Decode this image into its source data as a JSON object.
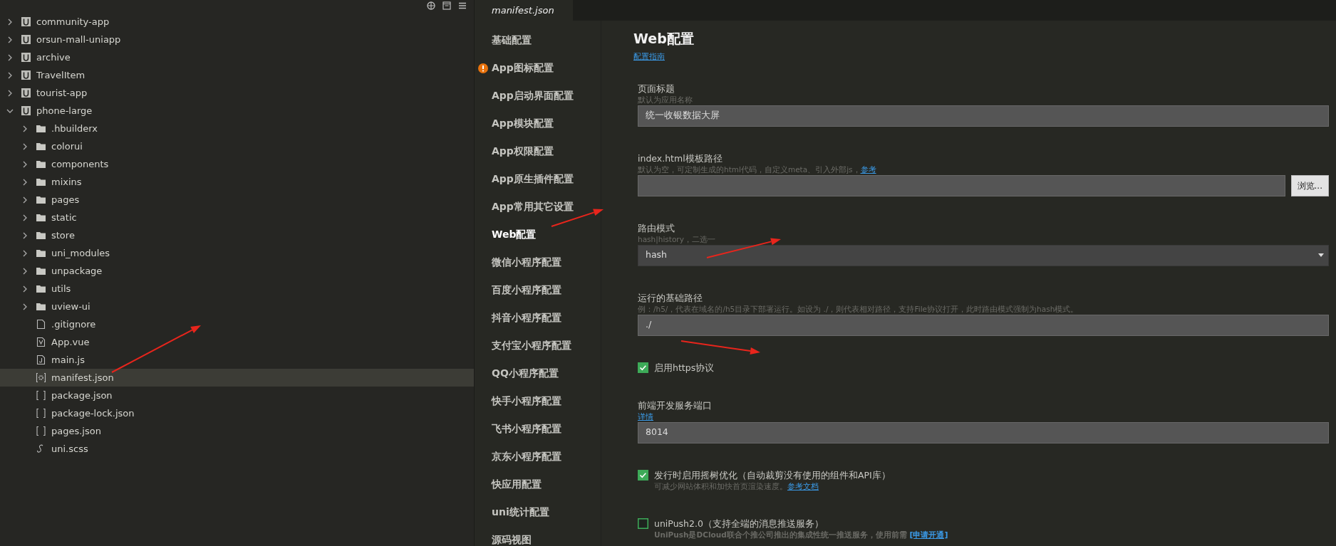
{
  "file_tree": [
    {
      "label": "community-app",
      "kind": "project",
      "expanded": false,
      "selected": false
    },
    {
      "label": "orsun-mall-uniapp",
      "kind": "project",
      "expanded": false,
      "selected": false
    },
    {
      "label": "archive",
      "kind": "project",
      "expanded": false,
      "selected": false
    },
    {
      "label": "TravelItem",
      "kind": "project",
      "expanded": false,
      "selected": false
    },
    {
      "label": "tourist-app",
      "kind": "project",
      "expanded": false,
      "selected": false
    },
    {
      "label": "phone-large",
      "kind": "project",
      "expanded": true,
      "selected": false,
      "children": [
        {
          "label": ".hbuilderx",
          "kind": "folder",
          "expanded": false,
          "selected": false
        },
        {
          "label": "colorui",
          "kind": "folder",
          "expanded": false,
          "selected": false
        },
        {
          "label": "components",
          "kind": "folder",
          "expanded": false,
          "selected": false
        },
        {
          "label": "mixins",
          "kind": "folder",
          "expanded": false,
          "selected": false
        },
        {
          "label": "pages",
          "kind": "folder",
          "expanded": false,
          "selected": false
        },
        {
          "label": "static",
          "kind": "folder",
          "expanded": false,
          "selected": false
        },
        {
          "label": "store",
          "kind": "folder",
          "expanded": false,
          "selected": false
        },
        {
          "label": "uni_modules",
          "kind": "folder",
          "expanded": false,
          "selected": false
        },
        {
          "label": "unpackage",
          "kind": "folder",
          "expanded": false,
          "selected": false
        },
        {
          "label": "utils",
          "kind": "folder",
          "expanded": false,
          "selected": false
        },
        {
          "label": "uview-ui",
          "kind": "folder",
          "expanded": false,
          "selected": false
        },
        {
          "label": ".gitignore",
          "kind": "plain",
          "selected": false
        },
        {
          "label": "App.vue",
          "kind": "vue",
          "selected": false
        },
        {
          "label": "main.js",
          "kind": "js",
          "selected": false
        },
        {
          "label": "manifest.json",
          "kind": "manifest",
          "selected": true
        },
        {
          "label": "package.json",
          "kind": "json",
          "selected": false
        },
        {
          "label": "package-lock.json",
          "kind": "json",
          "selected": false
        },
        {
          "label": "pages.json",
          "kind": "json",
          "selected": false
        },
        {
          "label": "uni.scss",
          "kind": "style",
          "selected": false
        }
      ]
    }
  ],
  "tab": {
    "label": "manifest.json"
  },
  "nav": [
    {
      "label": "基础配置",
      "selected": false,
      "warning": false
    },
    {
      "label": "App图标配置",
      "selected": false,
      "warning": true
    },
    {
      "label": "App启动界面配置",
      "selected": false,
      "warning": false
    },
    {
      "label": "App模块配置",
      "selected": false,
      "warning": false
    },
    {
      "label": "App权限配置",
      "selected": false,
      "warning": false
    },
    {
      "label": "App原生插件配置",
      "selected": false,
      "warning": false
    },
    {
      "label": "App常用其它设置",
      "selected": false,
      "warning": false
    },
    {
      "label": "Web配置",
      "selected": true,
      "warning": false
    },
    {
      "label": "微信小程序配置",
      "selected": false,
      "warning": false
    },
    {
      "label": "百度小程序配置",
      "selected": false,
      "warning": false
    },
    {
      "label": "抖音小程序配置",
      "selected": false,
      "warning": false
    },
    {
      "label": "支付宝小程序配置",
      "selected": false,
      "warning": false
    },
    {
      "label": "QQ小程序配置",
      "selected": false,
      "warning": false
    },
    {
      "label": "快手小程序配置",
      "selected": false,
      "warning": false
    },
    {
      "label": "飞书小程序配置",
      "selected": false,
      "warning": false
    },
    {
      "label": "京东小程序配置",
      "selected": false,
      "warning": false
    },
    {
      "label": "快应用配置",
      "selected": false,
      "warning": false
    },
    {
      "label": "uni统计配置",
      "selected": false,
      "warning": false
    },
    {
      "label": "源码视图",
      "selected": false,
      "warning": false
    }
  ],
  "content": {
    "title": "Web配置",
    "guide_link": "配置指南",
    "fields": [
      {
        "kind": "text",
        "label": "页面标题",
        "hint": "默认为应用名称",
        "value": "统一收银数据大屏"
      },
      {
        "kind": "file",
        "label": "index.html模板路径",
        "hint": "默认为空，可定制生成的html代码，自定义meta、引入外部js，",
        "hint_link": "参考",
        "button": "浏览..."
      },
      {
        "kind": "select",
        "label": "路由模式",
        "hint": "hash|history，二选一",
        "value": "hash"
      },
      {
        "kind": "text",
        "label": "运行的基础路径",
        "hint": "例：/h5/，代表在域名的/h5目录下部署运行。如设为 ./，则代表相对路径，支持File协议打开，此时路由模式强制为hash模式。",
        "value": "./"
      },
      {
        "kind": "checkbox",
        "label": "启用https协议",
        "checked": true
      },
      {
        "kind": "text",
        "label": "前端开发服务端口",
        "hint_link": "详情",
        "value": "8014"
      },
      {
        "kind": "checkbox",
        "label": "发行时启用摇树优化（自动裁剪没有使用的组件和API库）",
        "checked": true,
        "hint": "可减少网站体积和加快首页渲染速度。",
        "hint_link": "参考文档"
      },
      {
        "kind": "checkbox",
        "label": "uniPush2.0（支持全端的消息推送服务）",
        "checked": false,
        "hint": "UniPush是DCloud联合个推公司推出的集成性统一推送服务，使用前需 ",
        "hint_link": "[申请开通]",
        "hint_bold": true
      }
    ]
  }
}
